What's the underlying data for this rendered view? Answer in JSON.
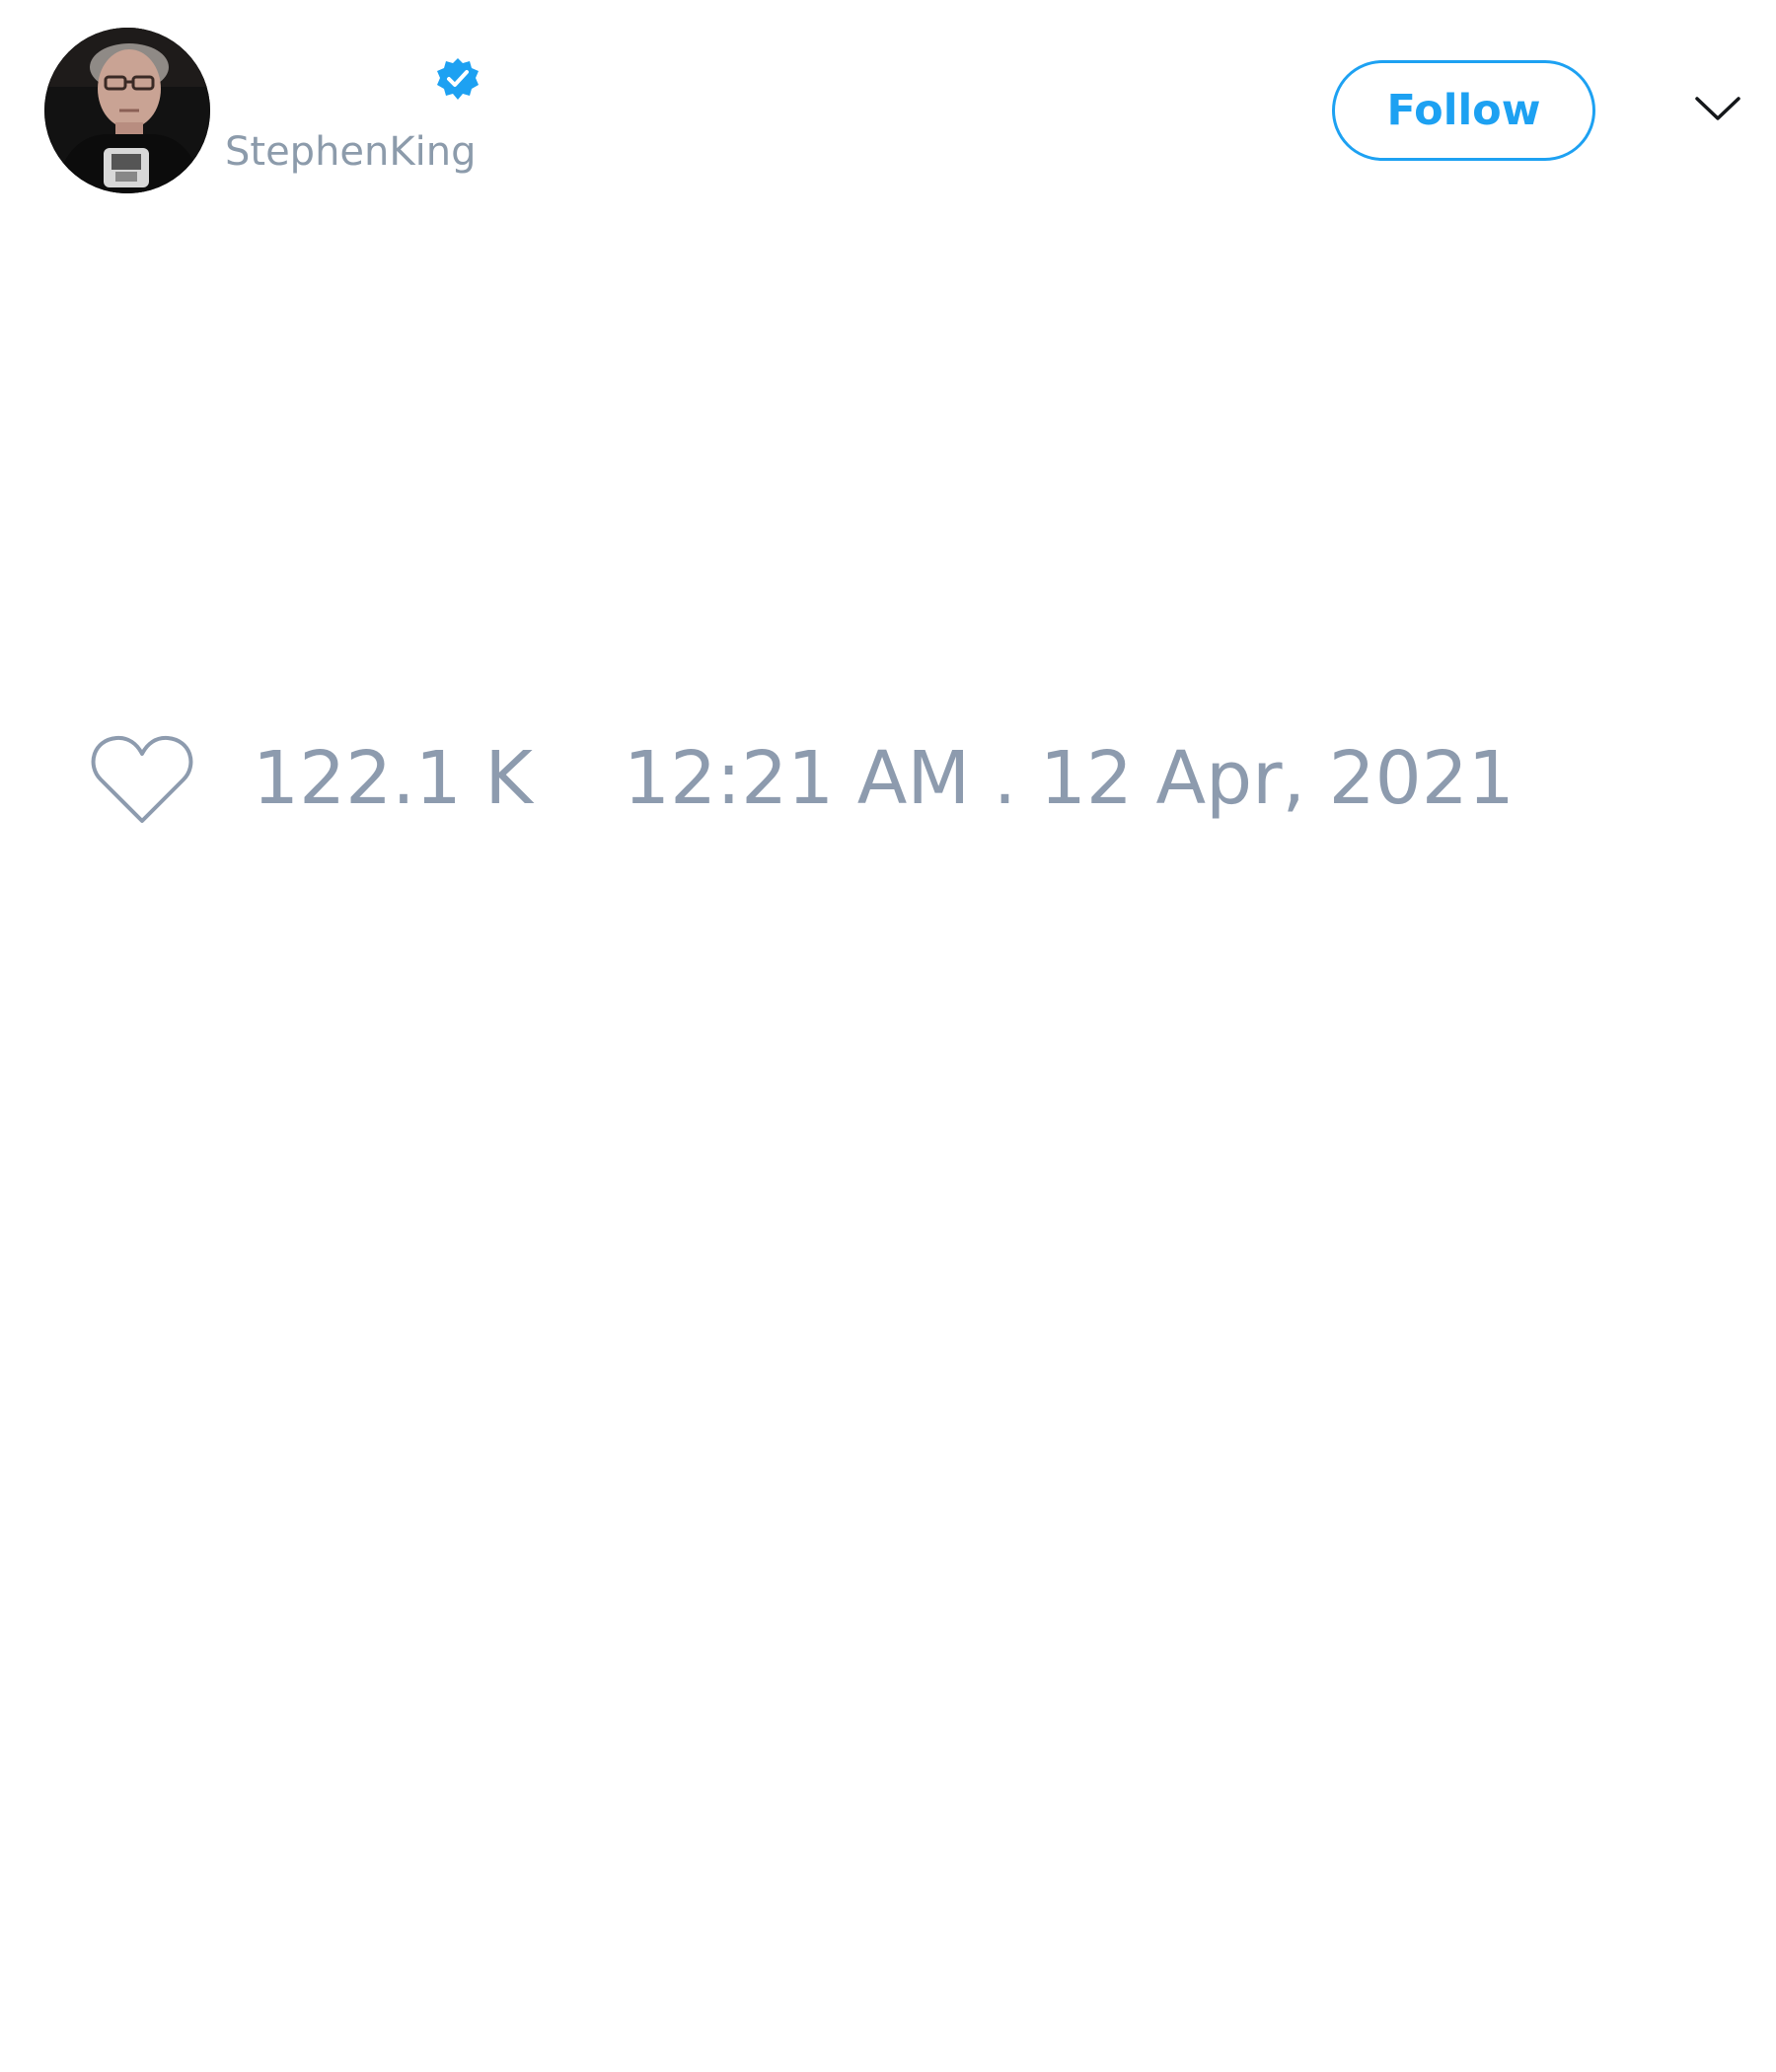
{
  "tweet": {
    "author": {
      "display_name": "",
      "handle": "StephenKing",
      "verified": true,
      "verified_icon": "verified-badge-icon",
      "avatar_icon": "profile-photo"
    },
    "actions": {
      "follow_label": "Follow",
      "menu_icon": "chevron-down-icon"
    },
    "stats": {
      "like_icon": "heart-icon",
      "likes": "122.1 K",
      "timestamp": "12:21 AM . 12 Apr, 2021"
    }
  },
  "colors": {
    "accent": "#1da1f2",
    "muted_text": "#8d9bae",
    "background": "#ffffff"
  }
}
